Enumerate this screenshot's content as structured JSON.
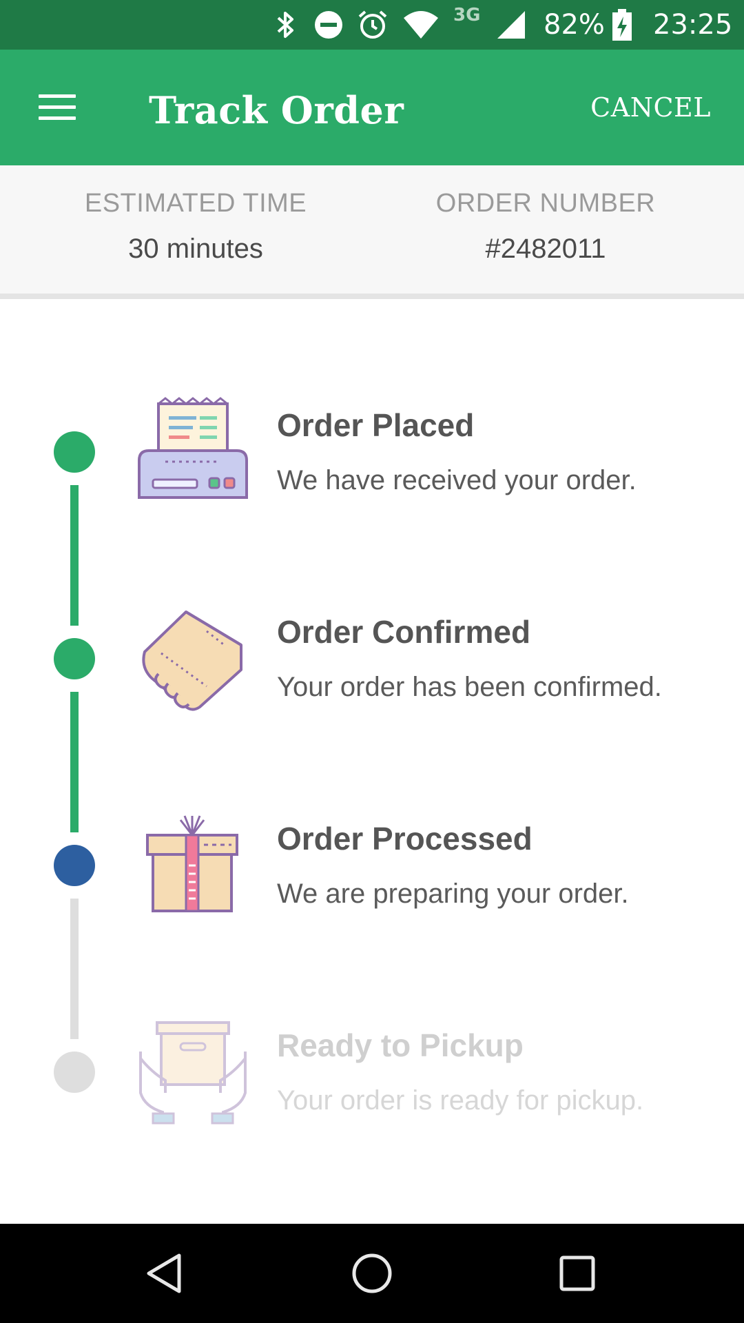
{
  "status_bar": {
    "network": "3G",
    "battery": "82%",
    "time": "23:25"
  },
  "app_bar": {
    "title": "Track Order",
    "cancel_label": "CANCEL"
  },
  "info": {
    "estimated_time_label": "ESTIMATED TIME",
    "estimated_time_value": "30 minutes",
    "order_number_label": "ORDER NUMBER",
    "order_number_value": "#2482011"
  },
  "steps": [
    {
      "title": "Order Placed",
      "description": "We have received your order.",
      "state": "done",
      "icon": "receipt-printer-icon"
    },
    {
      "title": "Order Confirmed",
      "description": "Your order has been confirmed.",
      "state": "done",
      "icon": "handshake-icon"
    },
    {
      "title": "Order Processed",
      "description": "We are preparing your order.",
      "state": "current",
      "icon": "gift-box-icon"
    },
    {
      "title": "Ready to Pickup",
      "description": "Your order is ready for pickup.",
      "state": "pending",
      "icon": "box-in-hands-icon"
    }
  ],
  "colors": {
    "status_bar": "#1f7a46",
    "primary": "#2bab69",
    "current": "#2d5fa0",
    "pending": "#d9d9d9"
  }
}
